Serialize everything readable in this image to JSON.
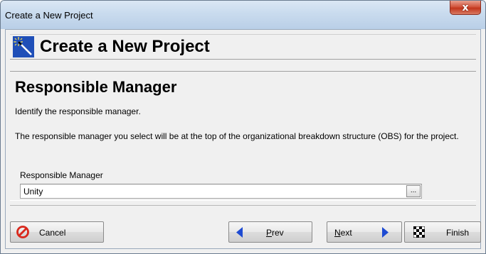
{
  "window": {
    "title": "Create a New Project",
    "close_label": "x"
  },
  "header": {
    "icon": "magic-wand-icon",
    "title": "Create a New Project"
  },
  "step": {
    "title": "Responsible Manager",
    "instruction": "Identify the responsible manager.",
    "description": "The responsible manager you select will be at the top of the organizational breakdown structure (OBS) for the project."
  },
  "field": {
    "label": "Responsible Manager",
    "value": "Unity",
    "browse_label": "..."
  },
  "buttons": {
    "cancel": "Cancel",
    "prev_mnemonic": "P",
    "prev_rest": "rev",
    "next_mnemonic": "N",
    "next_rest": "ext",
    "finish": "Finish"
  },
  "colors": {
    "header_icon_bg": "#1f4fb8",
    "cancel_icon": "#d9281c",
    "nav_arrow": "#1e4bd2"
  }
}
